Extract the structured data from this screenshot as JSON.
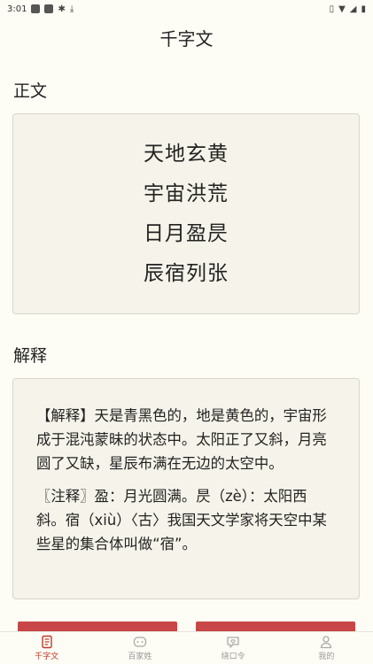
{
  "status_bar": {
    "time": "3:01"
  },
  "header": {
    "title": "千字文"
  },
  "sections": {
    "text_label": "正文",
    "explain_label": "解释"
  },
  "poem": {
    "lines": [
      "天地玄黄",
      "宇宙洪荒",
      "日月盈昃",
      "辰宿列张"
    ]
  },
  "explanation": {
    "paragraphs": [
      "【解释】天是青黑色的，地是黄色的，宇宙形成于混沌蒙昧的状态中。太阳正了又斜，月亮圆了又缺，星辰布满在无边的太空中。",
      "〖注释〗盈：月光圆满。昃（zè）：太阳西斜。宿（xiù）〈古〉我国天文学家将天空中某些星的集合体叫做“宿”。"
    ]
  },
  "tabs": [
    {
      "label": "千字文",
      "icon": "book-icon",
      "active": true
    },
    {
      "label": "百家姓",
      "icon": "face-icon",
      "active": false
    },
    {
      "label": "绕口令",
      "icon": "heart-chat-icon",
      "active": false
    },
    {
      "label": "我的",
      "icon": "user-icon",
      "active": false
    }
  ],
  "colors": {
    "accent": "#c0392b",
    "button": "#c94646",
    "background": "#fdfcf5",
    "card": "#f6f4ea"
  }
}
